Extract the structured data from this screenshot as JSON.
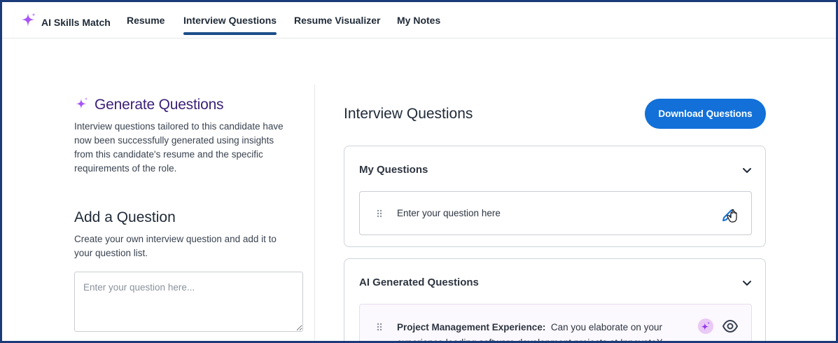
{
  "nav": {
    "brand": "AI Skills Match",
    "tabs": [
      {
        "label": "Resume"
      },
      {
        "label": "Interview Questions",
        "active": true
      },
      {
        "label": "Resume Visualizer"
      },
      {
        "label": "My Notes"
      }
    ]
  },
  "generate": {
    "title": "Generate Questions",
    "description": "Interview questions tailored to this candidate have now been successfully generated using insights from this candidate's resume and the specific requirements of the role."
  },
  "add_question": {
    "title": "Add a Question",
    "description": "Create your own interview question and add it to your question list.",
    "placeholder": "Enter your question here..."
  },
  "interview": {
    "title": "Interview Questions",
    "download_label": "Download Questions"
  },
  "my_questions": {
    "title": "My Questions",
    "items": [
      {
        "text": "Enter your question here"
      }
    ]
  },
  "ai_questions": {
    "title": "AI Generated Questions",
    "items": [
      {
        "heading": "Project Management Experience:",
        "text": "Can you elaborate on your experience leading software development projects at InnovateX"
      }
    ]
  },
  "icons": {
    "brand": "sparkle-icon",
    "generate": "sparkle-icon",
    "collapse": "chevron-down-icon",
    "drag": "drag-handle-icon",
    "edit": "pencil-icon",
    "ai_badge": "sparkle-icon",
    "view": "eye-icon"
  },
  "colors": {
    "accent": "#1270d8",
    "active_tab_underline": "#1c4e8a",
    "generate_title": "#3b1f78",
    "sparkle": "#a855f7"
  }
}
